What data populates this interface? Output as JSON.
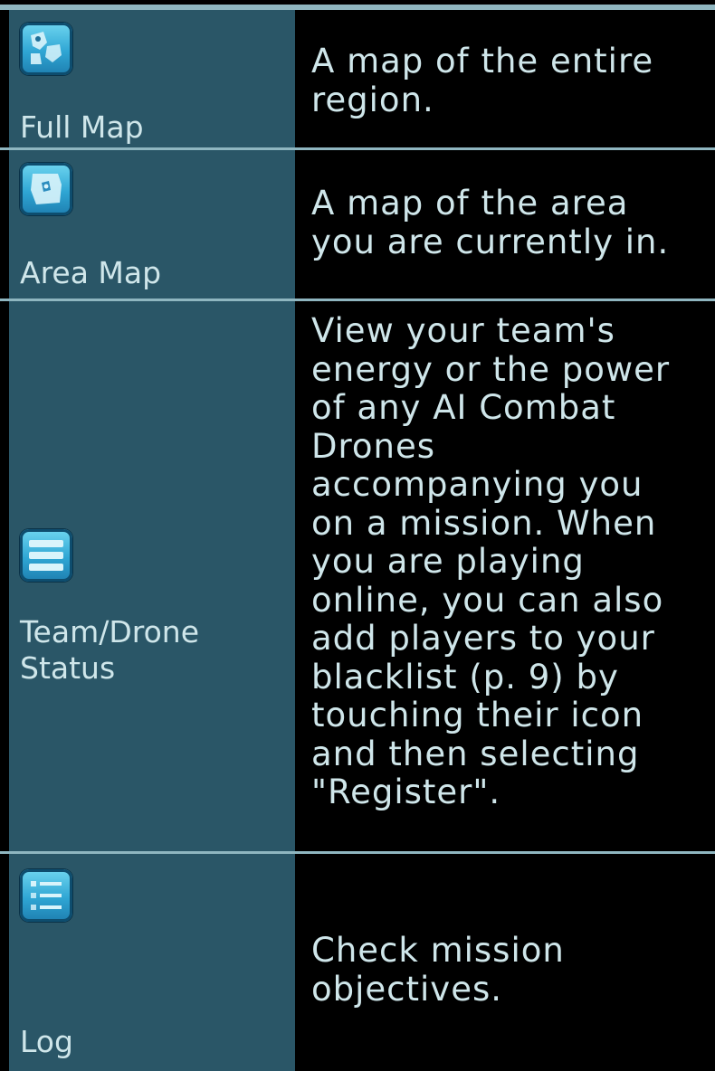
{
  "rows": [
    {
      "label_lines": [
        "Full Map"
      ],
      "icon": "full-map-icon",
      "description_lines": [
        "A map of the entire",
        "region."
      ]
    },
    {
      "label_lines": [
        "Area Map"
      ],
      "icon": "area-map-icon",
      "description_lines": [
        "A map of the area",
        "you are currently in."
      ]
    },
    {
      "label_lines": [
        "Team/Drone",
        "Status"
      ],
      "icon": "team-drone-status-icon",
      "description_lines": [
        "View your team's",
        "energy or the power",
        "of any AI Combat",
        "Drones",
        "accompanying you",
        "on a mission. When",
        "you are playing",
        "online, you can also",
        "add players to your",
        "blacklist (p. 9) by",
        "touching their icon",
        "and then selecting",
        "\"Register\"."
      ]
    },
    {
      "label_lines": [
        "Log"
      ],
      "icon": "log-icon",
      "description_lines": [
        "Check mission",
        "objectives."
      ]
    }
  ],
  "colors": {
    "left_cell": "#2a5667",
    "right_cell": "#000000",
    "border": "#8fb6c0",
    "text": "#cfe6ea",
    "icon_accent": "#2fa6d4"
  }
}
